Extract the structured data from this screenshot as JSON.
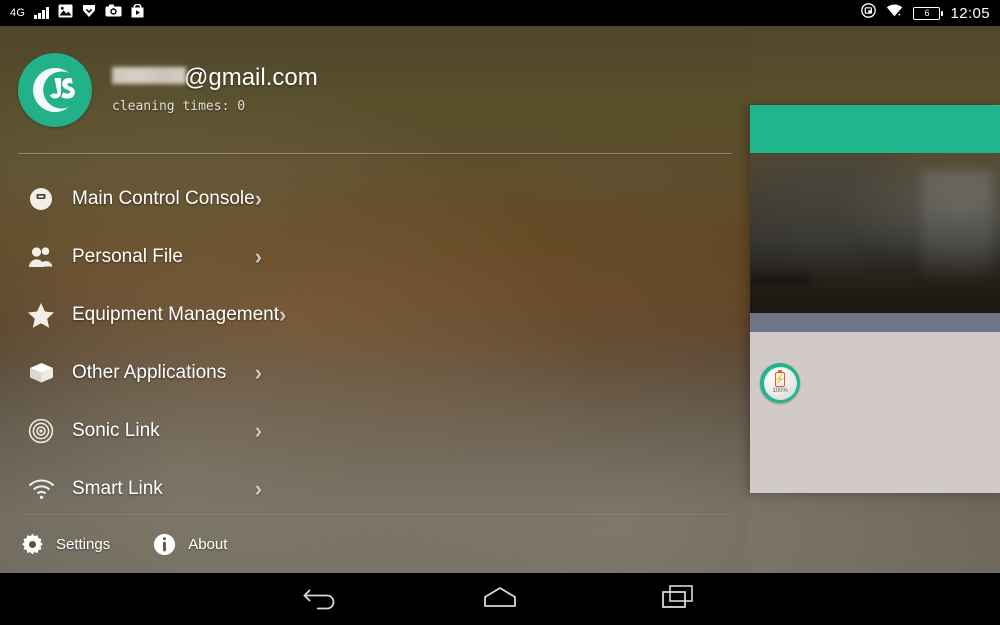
{
  "statusbar": {
    "network_label": "4G",
    "signal_icon": "signal-bars-icon",
    "icons": [
      "image-icon",
      "download-icon",
      "camera-icon",
      "play-store-icon"
    ],
    "right_icons": [
      "screenshot-icon",
      "wifi-icon"
    ],
    "battery_level": "6",
    "clock": "12:05"
  },
  "account": {
    "avatar_icon": "app-logo-js-icon",
    "email_domain": "@gmail.com",
    "email_username_redacted": true,
    "subtitle": "cleaning times: 0"
  },
  "menu": {
    "items": [
      {
        "label": "Main Control Console",
        "icon": "robot-vacuum-icon",
        "chevron": "›"
      },
      {
        "label": "Personal File",
        "icon": "people-icon",
        "chevron": "›"
      },
      {
        "label": "Equipment Management",
        "icon": "star-icon",
        "chevron": "›"
      },
      {
        "label": "Other Applications",
        "icon": "box-icon",
        "chevron": "›"
      },
      {
        "label": "Sonic Link",
        "icon": "radar-icon",
        "chevron": "›"
      },
      {
        "label": "Smart Link",
        "icon": "wifi-arcs-icon",
        "chevron": "›"
      }
    ]
  },
  "footer": {
    "settings_label": "Settings",
    "settings_icon": "gear-icon",
    "about_label": "About",
    "about_icon": "info-icon"
  },
  "side_card": {
    "appbar_color": "#1fb68d",
    "strip_color": "#6e7787",
    "body_color": "#d2cac7",
    "battery_badge": {
      "icon": "battery-charging-icon",
      "percent": "100%"
    }
  },
  "navbar": {
    "buttons": [
      {
        "name": "back",
        "icon": "back-arrow-icon"
      },
      {
        "name": "home",
        "icon": "home-icon"
      },
      {
        "name": "recents",
        "icon": "recents-icon"
      }
    ]
  },
  "colors": {
    "accent_teal": "#1fb68d",
    "battery_orange": "#ef5a22",
    "card_strip_slate": "#6e7787",
    "card_body_grey": "#d2cac7"
  }
}
